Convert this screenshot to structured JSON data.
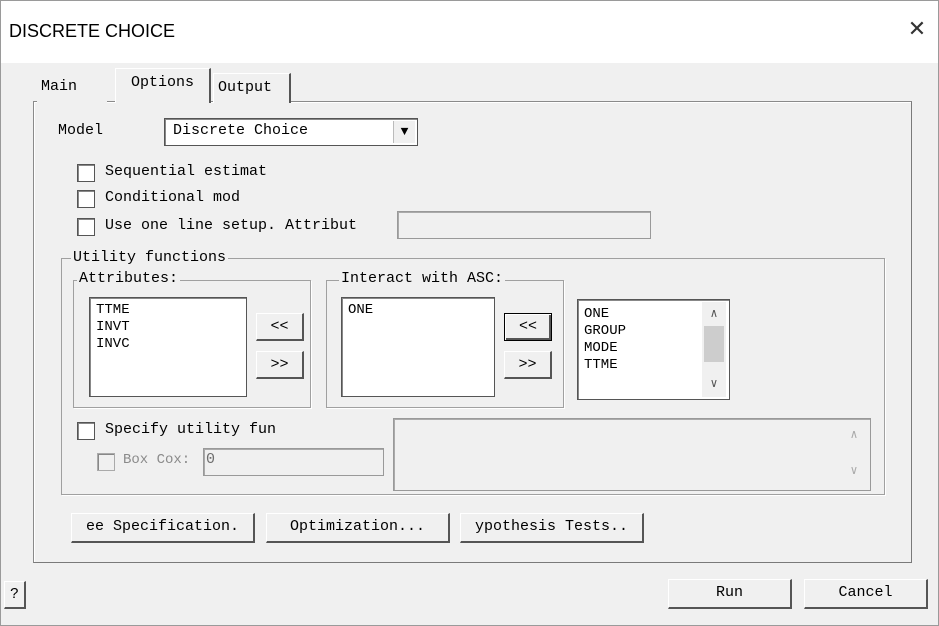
{
  "window": {
    "title": "DISCRETE CHOICE",
    "close_glyph": "✕"
  },
  "tabs": [
    {
      "label": "Main"
    },
    {
      "label": "Options"
    },
    {
      "label": "Output"
    }
  ],
  "model": {
    "label": "Model",
    "value": "Discrete Choice"
  },
  "checkboxes": {
    "sequential": "Sequential estimat",
    "conditional": "Conditional mod",
    "one_line": "Use one line setup. Attribut"
  },
  "one_line_field": {
    "value": ""
  },
  "utility": {
    "group_title": "Utility functions",
    "attributes": {
      "title": "Attributes:",
      "items": [
        "TTME",
        "INVT",
        "INVC"
      ]
    },
    "interact": {
      "title": "Interact with ASC:",
      "items": [
        "ONE"
      ]
    },
    "variables": [
      "ONE",
      "GROUP",
      "MODE",
      "TTME"
    ],
    "move_left": "<<",
    "move_right": ">>",
    "specify": "Specify utility fun",
    "box_cox": {
      "label": "Box Cox:",
      "value": "0"
    }
  },
  "buttons": {
    "specification": "ee Specification.",
    "optimization": "Optimization...",
    "hypothesis": "ypothesis Tests..",
    "help": "?",
    "run": "Run",
    "cancel": "Cancel"
  }
}
